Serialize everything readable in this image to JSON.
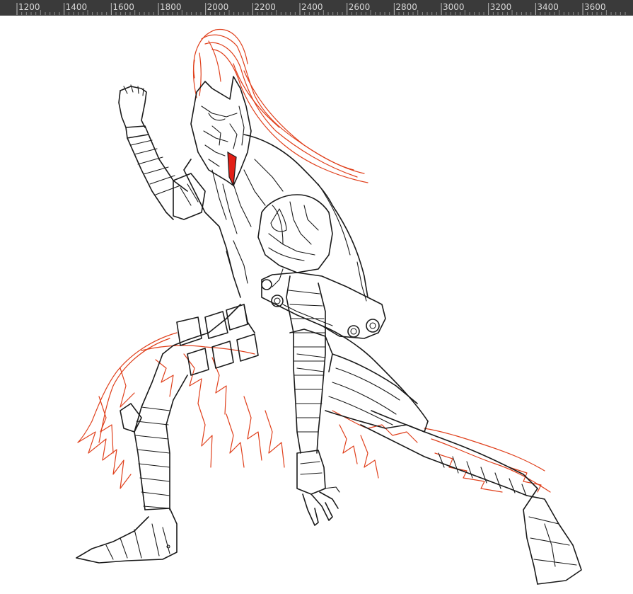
{
  "ruler": {
    "labels": [
      "1200",
      "1400",
      "1600",
      "1800",
      "2000",
      "2200",
      "2400",
      "2600",
      "2800",
      "3000",
      "3200",
      "3400",
      "3600"
    ]
  },
  "colors": {
    "ruler_bg": "#3a3a3a",
    "ruler_text": "#d8d8d8",
    "line_art": "#1a1a1a",
    "flame_red": "#e0401c",
    "canvas": "#ffffff"
  },
  "canvas": {
    "content": "armored-knight-line-art-sketch"
  }
}
